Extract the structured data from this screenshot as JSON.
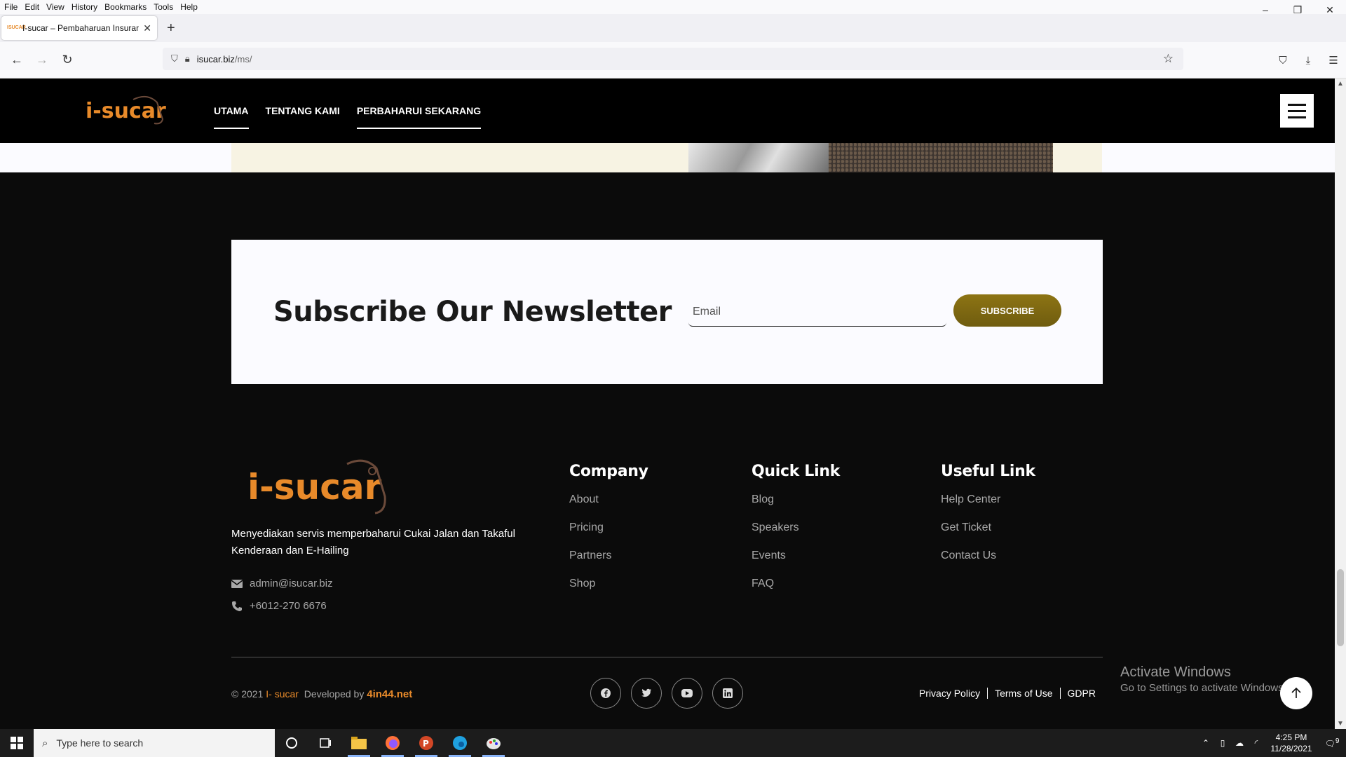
{
  "browser": {
    "menu": [
      "File",
      "Edit",
      "View",
      "History",
      "Bookmarks",
      "Tools",
      "Help"
    ],
    "window_controls": {
      "minimize": "–",
      "restore": "❐",
      "close": "✕"
    },
    "tab": {
      "favicon": "ISUCAR",
      "title": "I-sucar – Pembaharuan Insuran",
      "close": "✕"
    },
    "new_tab": "+",
    "url": {
      "domain": "isucar.biz",
      "path": "/ms/"
    }
  },
  "site": {
    "nav": [
      "UTAMA",
      "TENTANG KAMI",
      "PERBAHARUI SEKARANG"
    ],
    "logo_text": "i-sucar",
    "newsletter": {
      "title": "Subscribe Our Newsletter",
      "email_placeholder": "Email",
      "button": "SUBSCRIBE"
    },
    "footer": {
      "description": "Menyediakan servis memperbaharui Cukai Jalan dan Takaful Kenderaan dan E-Hailing",
      "email": "admin@isucar.biz",
      "phone": "+6012-270 6676",
      "columns": [
        {
          "title": "Company",
          "links": [
            "About",
            "Pricing",
            "Partners",
            "Shop"
          ]
        },
        {
          "title": "Quick Link",
          "links": [
            "Blog",
            "Speakers",
            "Events",
            "FAQ"
          ]
        },
        {
          "title": "Useful Link",
          "links": [
            "Help Center",
            "Get Ticket",
            "Contact Us"
          ]
        }
      ],
      "copyright_prefix": "© 2021",
      "copyright_brand": "I- sucar",
      "developed_by": "Developed by",
      "developer": "4in44.net",
      "socials": [
        "facebook-icon",
        "twitter-icon",
        "youtube-icon",
        "linkedin-icon"
      ],
      "legal": [
        "Privacy Policy",
        "Terms of Use",
        "GDPR"
      ]
    },
    "activate": {
      "title": "Activate Windows",
      "subtitle": "Go to Settings to activate Windows."
    },
    "colors": {
      "accent": "#e88a2a",
      "button": "#7d6712",
      "dark": "#0b0b0b"
    }
  },
  "taskbar": {
    "search_placeholder": "Type here to search",
    "time": "4:25 PM",
    "date": "11/28/2021",
    "notifications": "9"
  }
}
